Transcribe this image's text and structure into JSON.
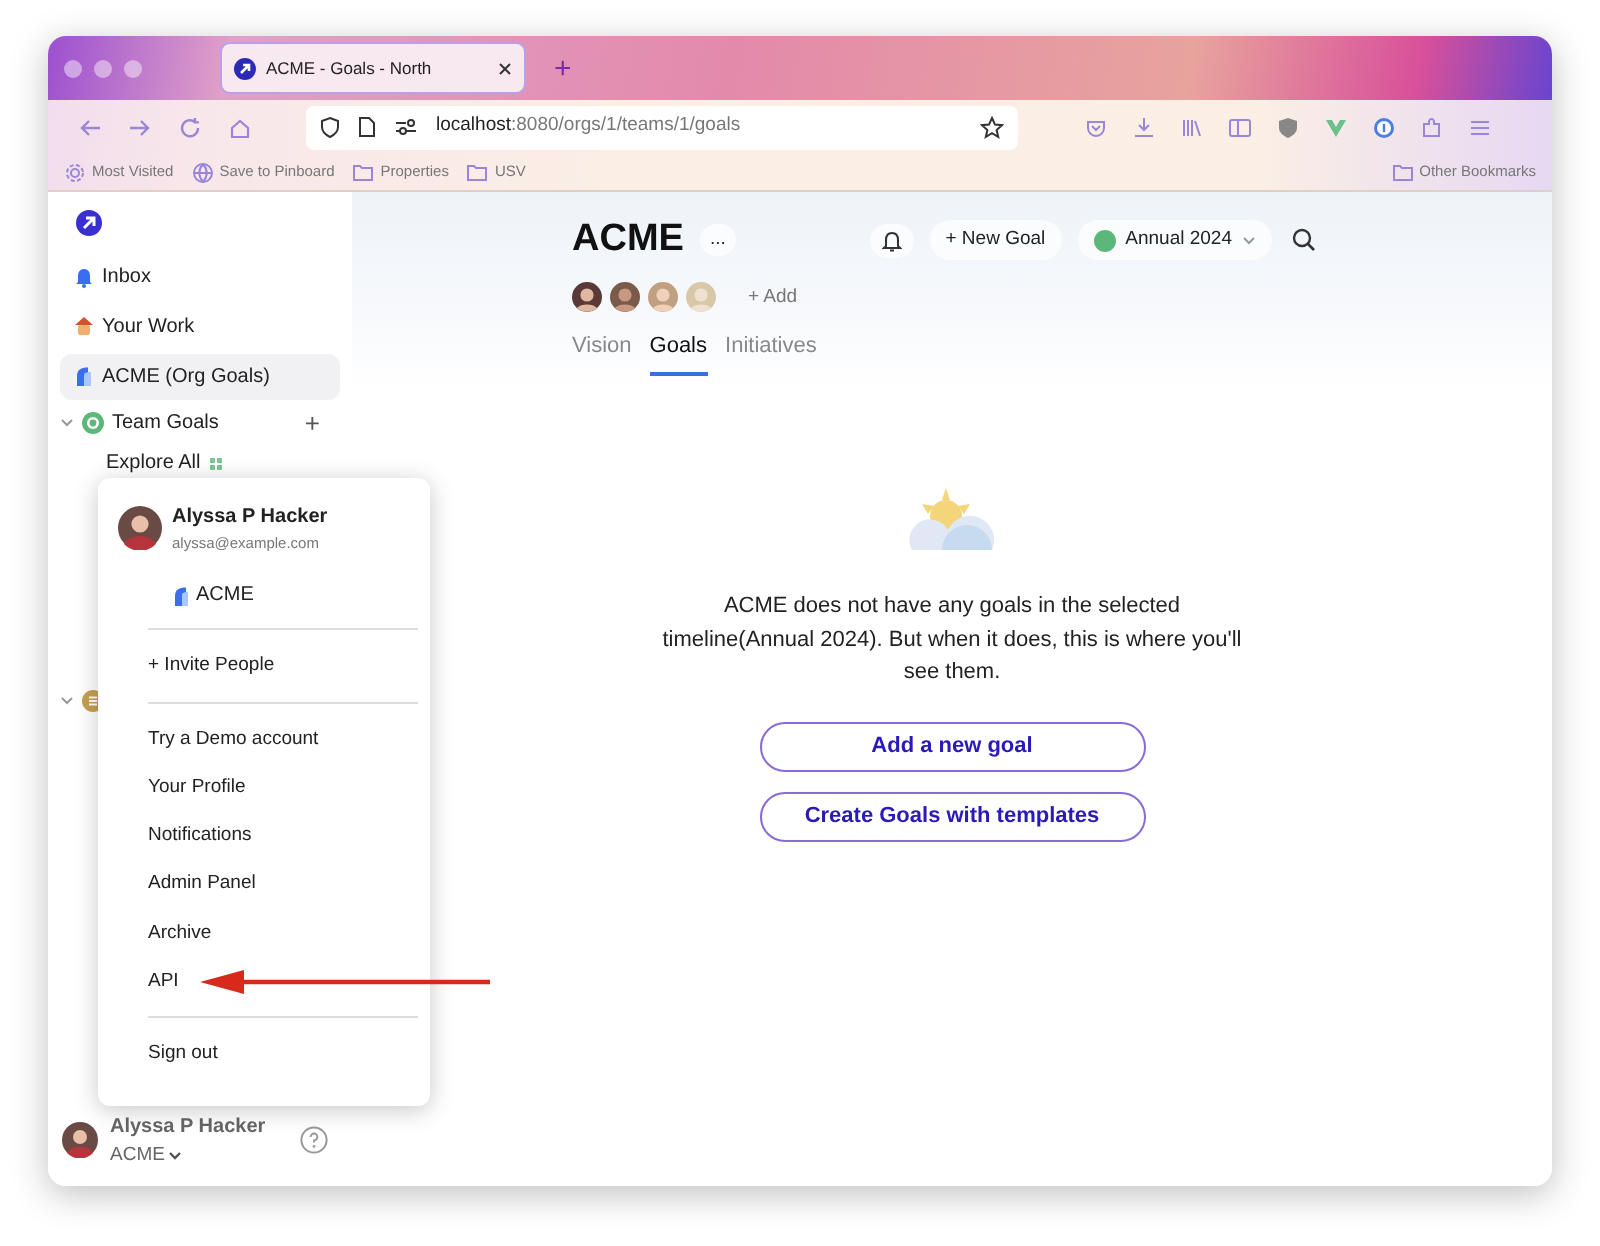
{
  "browser": {
    "tab": {
      "title": "ACME - Goals - North"
    },
    "new_tab": "+",
    "url": {
      "host": "localhost",
      "path": ":8080/orgs/1/teams/1/goals"
    },
    "bookmarks": [
      "Most Visited",
      "Save to Pinboard",
      "Properties",
      "USV"
    ],
    "other_bookmarks": "Other Bookmarks"
  },
  "sidebar": {
    "items": [
      {
        "label": "Inbox",
        "kind": "inbox",
        "selected": false
      },
      {
        "label": "Your Work",
        "kind": "work",
        "selected": false
      },
      {
        "label": "ACME (Org Goals)",
        "kind": "org",
        "selected": true
      }
    ],
    "team_goals": {
      "label": "Team Goals",
      "expanded": true,
      "add": "+",
      "children": [
        {
          "label": "Explore All"
        }
      ]
    },
    "user": {
      "name": "Alyssa P Hacker",
      "org": "ACME"
    }
  },
  "user_menu": {
    "name": "Alyssa P Hacker",
    "email": "alyssa@example.com",
    "org": "ACME",
    "groups": [
      [
        "+ Invite People"
      ],
      [
        "Try a Demo account",
        "Your Profile",
        "Notifications",
        "Admin Panel",
        "Archive",
        "API"
      ],
      [
        "Sign out"
      ]
    ]
  },
  "header": {
    "title": "ACME",
    "more": "...",
    "new_goal": "+ New Goal",
    "timeline": "Annual 2024",
    "add_member": "+ Add"
  },
  "tabs": [
    {
      "label": "Vision",
      "selected": false
    },
    {
      "label": "Goals",
      "selected": true
    },
    {
      "label": "Initiatives",
      "selected": false
    }
  ],
  "empty_state": {
    "message": "ACME does not have any goals in the selected timeline(Annual 2024). But when it does, this is where you'll see them.",
    "buttons": [
      "Add a new goal",
      "Create Goals with templates"
    ]
  }
}
